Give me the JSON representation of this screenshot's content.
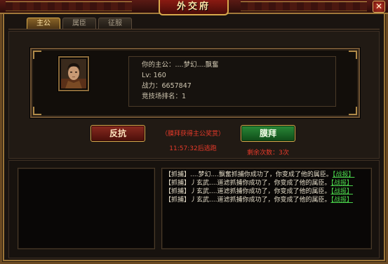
{
  "window": {
    "title": "外交府",
    "close_glyph": "✕"
  },
  "tabs": [
    {
      "label": "主公",
      "active": true
    },
    {
      "label": "属臣",
      "active": false
    },
    {
      "label": "征服",
      "active": false
    }
  ],
  "lord": {
    "name_line": "你的主公：....梦幻....飘奮",
    "level_line": "Lv: 160",
    "power_line": "战力：6657847",
    "arena_line": "竞技场排名：1"
  },
  "actions": {
    "revolt_label": "反抗",
    "worship_label": "膜拜",
    "reward_note": "（膜拜获得主公奖赏）",
    "timer_text": "11:57:32后逃跑",
    "remaining_text": "剩余次数：3次"
  },
  "log": [
    {
      "text": "【抓捕】....梦幻....飘奮抓捕你成功了，你变成了他的属臣。",
      "link": "【战报】"
    },
    {
      "text": "【抓捕】丿玄武....道滤抓捕你成功了，你变成了他的属臣。",
      "link": "【战报】"
    },
    {
      "text": "【抓捕】丿玄武....道滤抓捕你成功了，你变成了他的属臣。",
      "link": "【战报】"
    },
    {
      "text": "【抓捕】丿玄武....道滤抓捕你成功了，你变成了他的属臣。",
      "link": "【战报】"
    }
  ],
  "colors": {
    "accent_gold": "#d7a94c",
    "alert_red": "#e83a2a",
    "link_green": "#49d24a",
    "worship_green": "#2a8a38",
    "revolt_red": "#8a2a20"
  }
}
